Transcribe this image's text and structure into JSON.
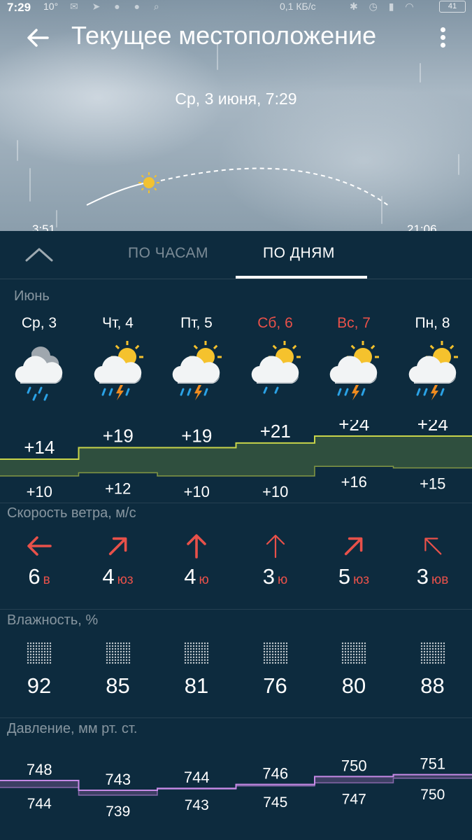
{
  "status": {
    "time": "7:29",
    "temp": "10°",
    "network": "0,1 КБ/с",
    "battery": "41"
  },
  "header": {
    "title": "Текущее местоположение"
  },
  "date_label": "Ср, 3 июня, 7:29",
  "sun": {
    "sunrise": "3:51",
    "sunset": "21:06"
  },
  "tabs": [
    {
      "label": "ПО ЧАСАМ",
      "active": false
    },
    {
      "label": "ПО ДНЯМ",
      "active": true
    }
  ],
  "month": "Июнь",
  "days": [
    {
      "name": "Ср, 3",
      "weekend": false,
      "icon": "cloud-rain-icon",
      "high": "+14",
      "low": "+10",
      "wind_speed": "6",
      "wind_dir": "в",
      "humidity": "92",
      "pressure_high": "748",
      "pressure_low": "744"
    },
    {
      "name": "Чт, 4",
      "weekend": false,
      "icon": "sun-cloud-thunderstorm-icon",
      "high": "+19",
      "low": "+12",
      "wind_speed": "4",
      "wind_dir": "юз",
      "humidity": "85",
      "pressure_high": "743",
      "pressure_low": "739"
    },
    {
      "name": "Пт, 5",
      "weekend": false,
      "icon": "sun-cloud-thunderstorm-icon",
      "high": "+19",
      "low": "+10",
      "wind_speed": "4",
      "wind_dir": "ю",
      "humidity": "81",
      "pressure_high": "744",
      "pressure_low": "743"
    },
    {
      "name": "Сб, 6",
      "weekend": true,
      "icon": "sun-cloud-rain-icon",
      "high": "+21",
      "low": "+10",
      "wind_speed": "3",
      "wind_dir": "ю",
      "humidity": "76",
      "pressure_high": "746",
      "pressure_low": "745"
    },
    {
      "name": "Вс, 7",
      "weekend": true,
      "icon": "sun-cloud-thunderstorm-icon",
      "high": "+24",
      "low": "+16",
      "wind_speed": "5",
      "wind_dir": "юз",
      "humidity": "80",
      "pressure_high": "750",
      "pressure_low": "747"
    },
    {
      "name": "Пн, 8",
      "weekend": false,
      "icon": "sun-cloud-thunderstorm-icon",
      "high": "+24",
      "low": "+15",
      "wind_speed": "3",
      "wind_dir": "юв",
      "humidity": "88",
      "pressure_high": "751",
      "pressure_low": "750"
    }
  ],
  "sections": {
    "wind": "Скорость ветра, м/с",
    "humidity": "Влажность, %",
    "pressure": "Давление, мм рт. ст."
  },
  "colors": {
    "background": "#0d2b3e",
    "weekend": "#e8514a",
    "wind_arrow": "#e8514a",
    "temp_band": "#2f4f3e",
    "temp_line": "#c8d44a",
    "pressure_band": "#3c3f63",
    "pressure_line": "#c68ae6"
  }
}
